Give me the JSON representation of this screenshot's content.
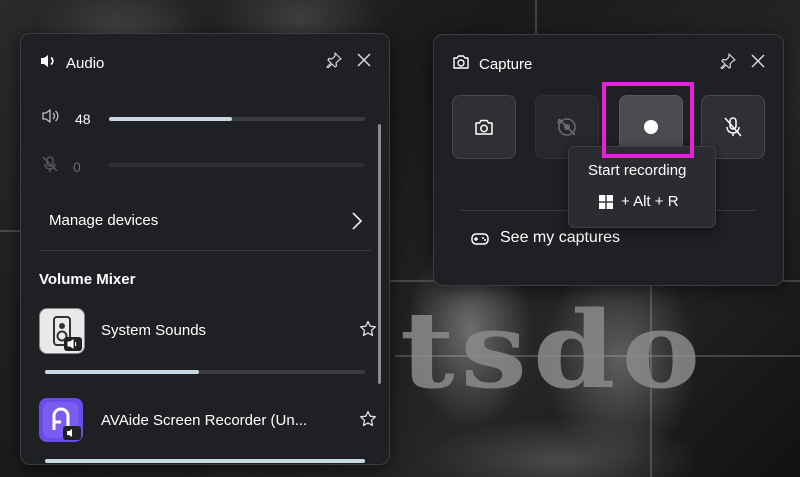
{
  "audio": {
    "title": "Audio",
    "speaker_volume": "48",
    "speaker_fill": 0.48,
    "mic_volume": "0",
    "mic_fill": 0.0,
    "manage_devices_label": "Manage devices",
    "mixer_title": "Volume Mixer",
    "apps": [
      {
        "name": "System Sounds",
        "fill": 0.48,
        "icon": "system-sounds-icon"
      },
      {
        "name": "AVAide Screen Recorder (Un...",
        "fill": 1.0,
        "icon": "avaide-icon"
      }
    ]
  },
  "capture": {
    "title": "Capture",
    "buttons": [
      {
        "name": "screenshot",
        "icon": "camera-icon",
        "state": "enabled"
      },
      {
        "name": "record-last",
        "icon": "record-history-icon",
        "state": "disabled"
      },
      {
        "name": "start-recording",
        "icon": "record-dot-icon",
        "state": "active"
      },
      {
        "name": "mic-toggle",
        "icon": "mic-off-icon",
        "state": "enabled"
      }
    ],
    "tooltip_title": "Start recording",
    "tooltip_shortcut": "+ Alt + R",
    "see_captures_label": "See my captures"
  },
  "colors": {
    "panel_bg": "#1f2023",
    "accent_fill": "#c9d7e0",
    "highlight": "#e61fd8"
  }
}
